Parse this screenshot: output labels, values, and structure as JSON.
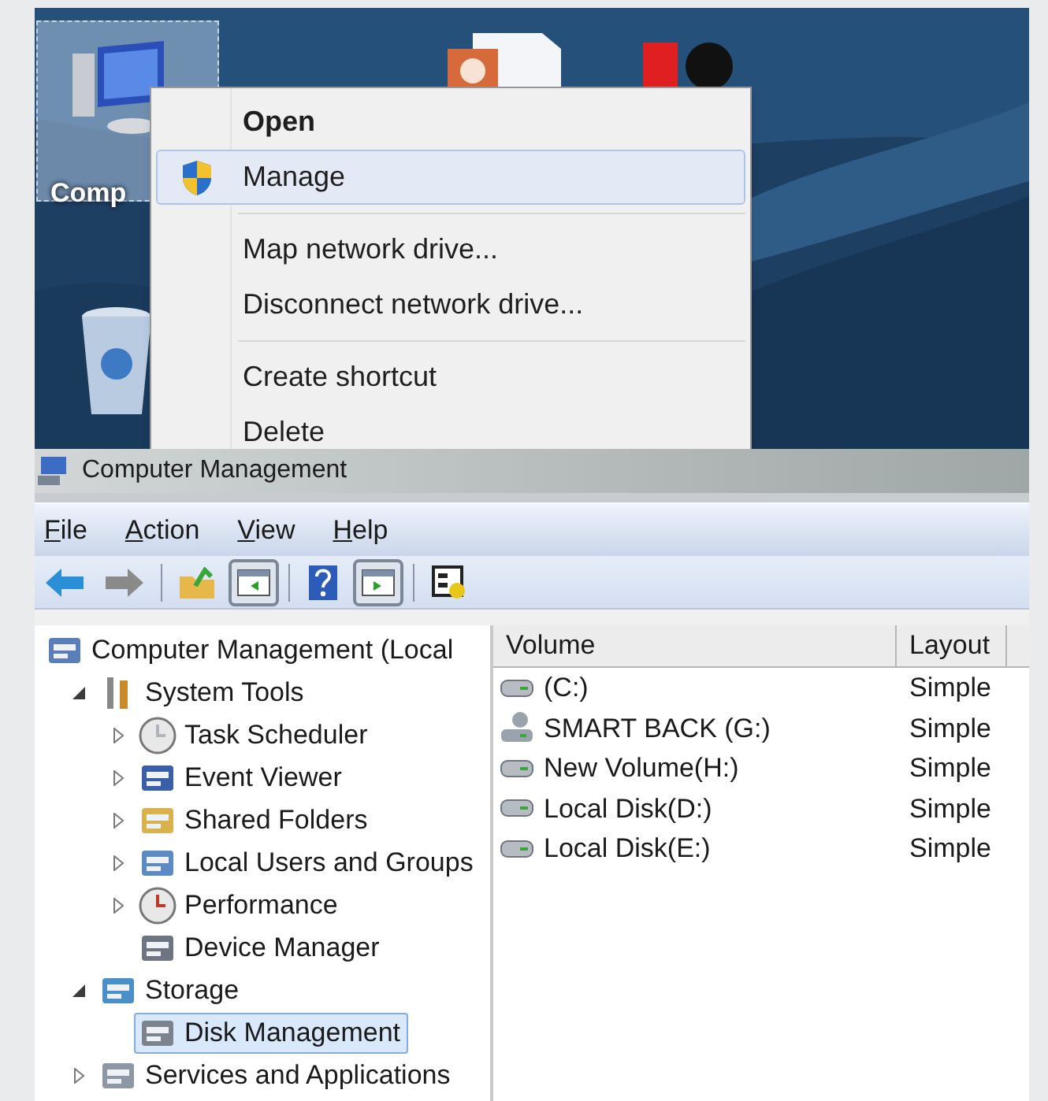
{
  "desktop": {
    "icons": [
      {
        "label": "Comp",
        "selected": true
      }
    ],
    "context_menu": [
      {
        "label": "Open",
        "kind": "default",
        "selected": false
      },
      {
        "label": "Manage",
        "kind": "shield",
        "selected": true
      },
      {
        "kind": "separator"
      },
      {
        "label": "Map network drive...",
        "kind": "item",
        "selected": false
      },
      {
        "label": "Disconnect network drive...",
        "kind": "item",
        "selected": false
      },
      {
        "kind": "separator"
      },
      {
        "label": "Create shortcut",
        "kind": "item",
        "selected": false
      },
      {
        "label": "Delete",
        "kind": "item",
        "selected": false
      }
    ]
  },
  "window": {
    "title": "Computer Management",
    "menu": [
      "File",
      "Action",
      "View",
      "Help"
    ],
    "toolbar": [
      {
        "pressed": false
      },
      {
        "pressed": false
      },
      {
        "kind": "separator"
      },
      {
        "pressed": false
      },
      {
        "pressed": true
      },
      {
        "kind": "separator"
      },
      {
        "pressed": false
      },
      {
        "pressed": true
      },
      {
        "kind": "separator"
      },
      {
        "pressed": false
      }
    ],
    "tree": [
      {
        "label": "Computer Management (Local",
        "selected": false,
        "children": [
          {
            "label": "System Tools",
            "expanded": true,
            "selected": false,
            "children": [
              {
                "label": "Task Scheduler",
                "expanded": false,
                "selected": false
              },
              {
                "label": "Event Viewer",
                "expanded": false,
                "selected": false
              },
              {
                "label": "Shared Folders",
                "expanded": false,
                "selected": false
              },
              {
                "label": "Local Users and Groups",
                "expanded": false,
                "selected": false
              },
              {
                "label": "Performance",
                "expanded": false,
                "selected": false
              },
              {
                "label": "Device Manager",
                "selected": false
              }
            ]
          },
          {
            "label": "Storage",
            "expanded": true,
            "selected": false,
            "children": [
              {
                "label": "Disk Management",
                "selected": true
              }
            ]
          },
          {
            "label": "Services and Applications",
            "expanded": false,
            "selected": false
          }
        ]
      }
    ],
    "table": {
      "columns": [
        "Volume",
        "Layout"
      ],
      "rows": [
        {
          "volume": "(C:)",
          "layout": "Simple"
        },
        {
          "volume": "SMART BACK (G:)",
          "layout": "Simple"
        },
        {
          "volume": "New Volume(H:)",
          "layout": "Simple"
        },
        {
          "volume": "Local Disk(D:)",
          "layout": "Simple"
        },
        {
          "volume": "Local Disk(E:)",
          "layout": "Simple"
        }
      ]
    }
  }
}
